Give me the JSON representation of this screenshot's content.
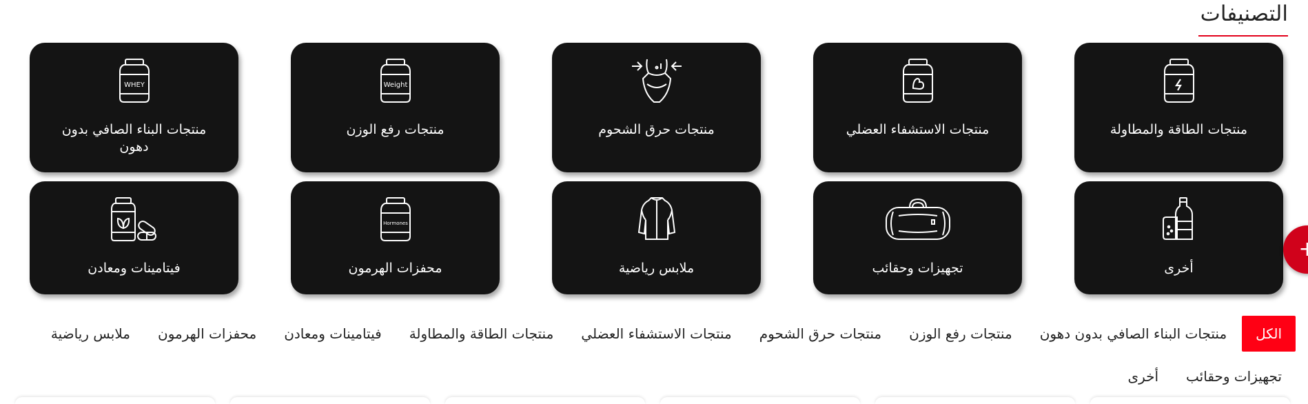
{
  "section": {
    "title": "التصنيفات",
    "accent_color": "#e2001a"
  },
  "categories": [
    {
      "label": "منتجات الطاقة والمطاولة",
      "icon": "energy-jar-icon"
    },
    {
      "label": "منتجات الاستشفاء العضلي",
      "icon": "muscle-recovery-jar-icon"
    },
    {
      "label": "منتجات حرق الشحوم",
      "icon": "fat-burn-waist-icon"
    },
    {
      "label": "منتجات رفع الوزن",
      "icon": "weight-jar-icon",
      "icon_text": "Weight"
    },
    {
      "label": "منتجات البناء الصافي بدون دهون",
      "icon": "whey-jar-icon",
      "icon_text": "WHEY"
    },
    {
      "label": "أخرى",
      "icon": "bottles-icon"
    },
    {
      "label": "تجهيزات وحقائب",
      "icon": "gym-bag-icon"
    },
    {
      "label": "ملابس رياضية",
      "icon": "sports-jersey-icon"
    },
    {
      "label": "محفزات الهرمون",
      "icon": "hormones-jar-icon",
      "icon_text": "Hormones"
    },
    {
      "label": "فيتامينات ومعادن",
      "icon": "vitamins-icon"
    }
  ],
  "fab": {
    "label": "+",
    "color": "#d0021b"
  },
  "filters": {
    "active_color": "#ff0014",
    "items": [
      {
        "label": "الكل",
        "active": true
      },
      {
        "label": "منتجات البناء الصافي بدون دهون"
      },
      {
        "label": "منتجات رفع الوزن"
      },
      {
        "label": "منتجات حرق الشحوم"
      },
      {
        "label": "منتجات الاستشفاء العضلي"
      },
      {
        "label": "منتجات الطاقة والمطاولة"
      },
      {
        "label": "فيتامينات ومعادن"
      },
      {
        "label": "محفزات الهرمون"
      },
      {
        "label": "ملابس رياضية"
      },
      {
        "label": "تجهيزات وحقائب"
      },
      {
        "label": "أخرى"
      }
    ]
  }
}
